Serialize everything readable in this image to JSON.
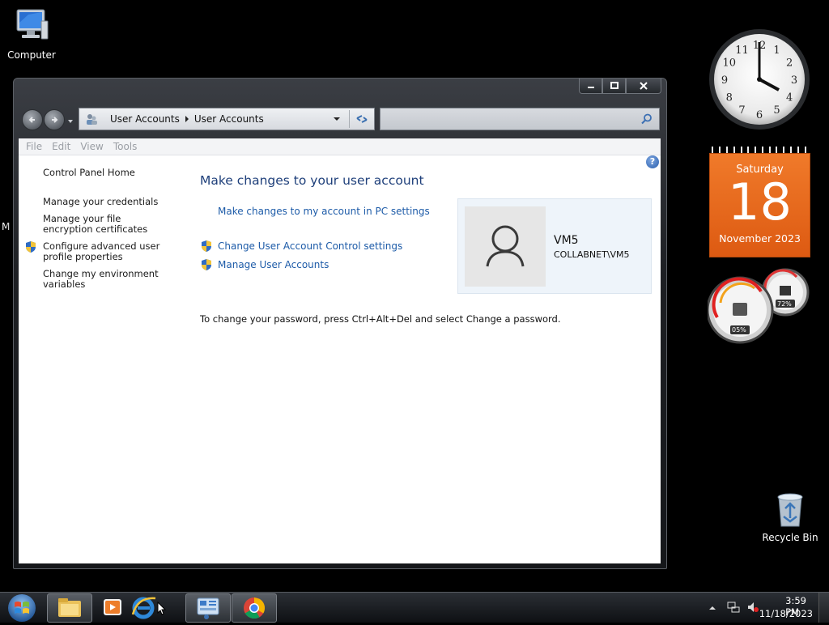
{
  "desktop": {
    "icons": [
      {
        "label": "Computer"
      },
      {
        "label": "Recycle Bin"
      }
    ],
    "partial_label": "M"
  },
  "clock_gadget": {
    "numbers": [
      "12",
      "1",
      "2",
      "3",
      "4",
      "5",
      "6",
      "7",
      "8",
      "9",
      "10",
      "11"
    ]
  },
  "calendar_gadget": {
    "weekday": "Saturday",
    "day": "18",
    "month_year": "November 2023"
  },
  "meter_gadget": {
    "cpu": "05%",
    "memory": "72%"
  },
  "window": {
    "address": {
      "crumbs": [
        "User Accounts",
        "User Accounts"
      ]
    },
    "menu": [
      "File",
      "Edit",
      "View",
      "Tools"
    ],
    "sidebar": {
      "home": "Control Panel Home",
      "links": [
        "Manage your credentials",
        "Manage your file encryption certificates",
        "Configure advanced user profile properties",
        "Change my environment variables"
      ]
    },
    "main": {
      "heading": "Make changes to your user account",
      "pc_settings_link": "Make changes to my account in PC settings",
      "uac_link": "Change User Account Control settings",
      "manage_link": "Manage User Accounts",
      "password_note": "To change your password, press Ctrl+Alt+Del and select Change a password."
    },
    "user": {
      "name": "VM5",
      "account": "COLLABNET\\VM5"
    }
  },
  "taskbar": {
    "time": "3:59 PM",
    "date": "11/18/2023"
  },
  "colors": {
    "link": "#1d5ba8",
    "heading": "#1e3f7a",
    "calendar": "#e8661a"
  }
}
